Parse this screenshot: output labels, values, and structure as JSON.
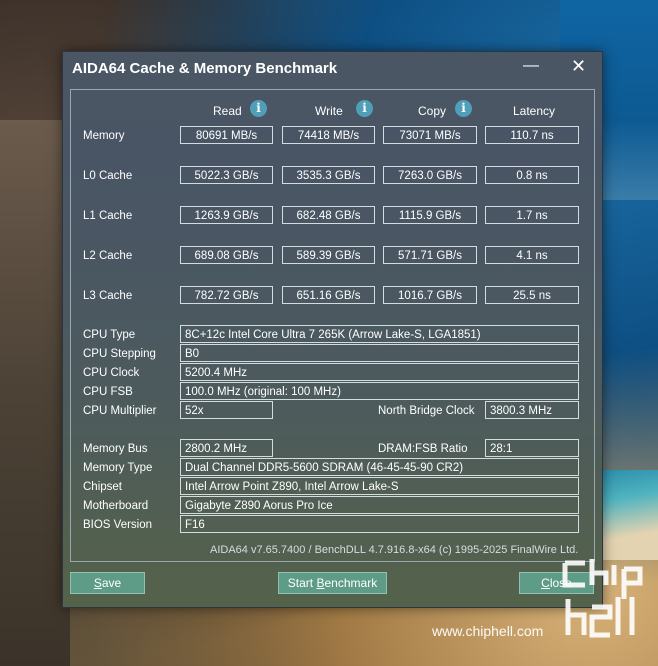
{
  "window": {
    "title": "AIDA64 Cache & Memory Benchmark",
    "min_glyph": "—",
    "close_glyph": "✕"
  },
  "columns": {
    "read": "Read",
    "write": "Write",
    "copy": "Copy",
    "latency": "Latency"
  },
  "rows": [
    {
      "label": "Memory",
      "read": "80691 MB/s",
      "write": "74418 MB/s",
      "copy": "73071 MB/s",
      "latency": "110.7 ns"
    },
    {
      "label": "L0 Cache",
      "read": "5022.3 GB/s",
      "write": "3535.3 GB/s",
      "copy": "7263.0 GB/s",
      "latency": "0.8 ns"
    },
    {
      "label": "L1 Cache",
      "read": "1263.9 GB/s",
      "write": "682.48 GB/s",
      "copy": "1115.9 GB/s",
      "latency": "1.7 ns"
    },
    {
      "label": "L2 Cache",
      "read": "689.08 GB/s",
      "write": "589.39 GB/s",
      "copy": "571.71 GB/s",
      "latency": "4.1 ns"
    },
    {
      "label": "L3 Cache",
      "read": "782.72 GB/s",
      "write": "651.16 GB/s",
      "copy": "1016.7 GB/s",
      "latency": "25.5 ns"
    }
  ],
  "cpu": {
    "type_label": "CPU Type",
    "type_value": "8C+12c Intel Core Ultra 7 265K  (Arrow Lake-S, LGA1851)",
    "stepping_label": "CPU Stepping",
    "stepping_value": "B0",
    "clock_label": "CPU Clock",
    "clock_value": "5200.4 MHz",
    "fsb_label": "CPU FSB",
    "fsb_value": "100.0 MHz  (original: 100 MHz)",
    "multiplier_label": "CPU Multiplier",
    "multiplier_value": "52x",
    "nb_clock_label": "North Bridge Clock",
    "nb_clock_value": "3800.3 MHz"
  },
  "memory": {
    "bus_label": "Memory Bus",
    "bus_value": "2800.2 MHz",
    "ratio_label": "DRAM:FSB Ratio",
    "ratio_value": "28:1",
    "type_label": "Memory Type",
    "type_value": "Dual Channel DDR5-5600 SDRAM  (46-45-45-90 CR2)",
    "chipset_label": "Chipset",
    "chipset_value": "Intel Arrow Point Z890, Intel Arrow Lake-S",
    "motherboard_label": "Motherboard",
    "motherboard_value": "Gigabyte Z890 Aorus Pro Ice",
    "bios_label": "BIOS Version",
    "bios_value": "F16"
  },
  "footer": "AIDA64 v7.65.7400 / BenchDLL 4.7.916.8-x64  (c) 1995-2025 FinalWire Ltd.",
  "buttons": {
    "save_first": "S",
    "save_rest": "ave",
    "start_pre": "Start ",
    "start_ul": "B",
    "start_post": "enchmark",
    "close_first": "C",
    "close_rest": "lose"
  },
  "watermark": {
    "site": "www.chiphell.com"
  },
  "colors": {
    "accent_button": "#5e9c88",
    "info_icon": "#4f9fb8"
  }
}
